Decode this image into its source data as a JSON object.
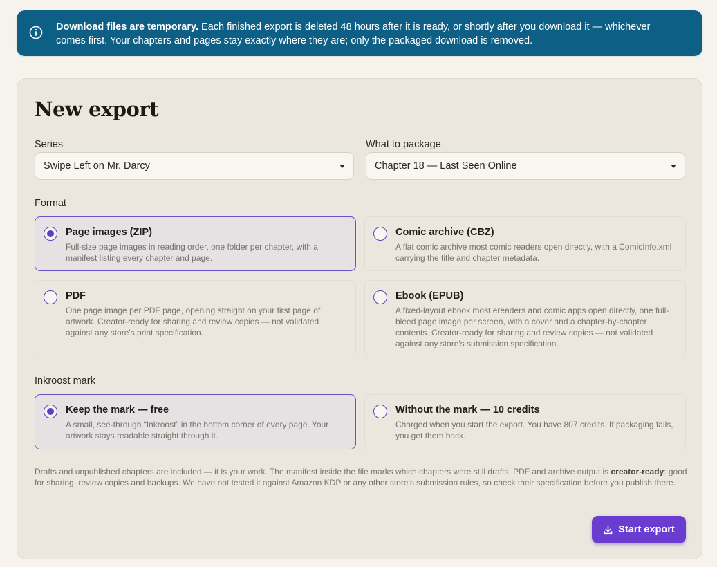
{
  "banner": {
    "icon": "info-icon",
    "bold": "Download files are temporary.",
    "text": " Each finished export is deleted 48 hours after it is ready, or shortly after you download it — whichever comes first. Your chapters and pages stay exactly where they are; only the packaged download is removed."
  },
  "card": {
    "title": "New export",
    "series": {
      "label": "Series",
      "value": "Swipe Left on Mr. Darcy"
    },
    "package": {
      "label": "What to package",
      "value": "Chapter 18 — Last Seen Online"
    },
    "format": {
      "label": "Format",
      "options": [
        {
          "title": "Page images (ZIP)",
          "desc": "Full-size page images in reading order, one folder per chapter, with a manifest listing every chapter and page.",
          "selected": true
        },
        {
          "title": "Comic archive (CBZ)",
          "desc": "A flat comic archive most comic readers open directly, with a ComicInfo.xml carrying the title and chapter metadata.",
          "selected": false
        },
        {
          "title": "PDF",
          "desc": "One page image per PDF page, opening straight on your first page of artwork. Creator-ready for sharing and review copies — not validated against any store's print specification.",
          "selected": false
        },
        {
          "title": "Ebook (EPUB)",
          "desc": "A fixed-layout ebook most ereaders and comic apps open directly, one full-bleed page image per screen, with a cover and a chapter-by-chapter contents. Creator-ready for sharing and review copies — not validated against any store's submission specification.",
          "selected": false
        }
      ]
    },
    "mark": {
      "label": "Inkroost mark",
      "options": [
        {
          "title": "Keep the mark — free",
          "desc": "A small, see-through “Inkroost” in the bottom corner of every page. Your artwork stays readable straight through it.",
          "selected": true
        },
        {
          "title": "Without the mark — 10 credits",
          "desc": "Charged when you start the export. You have 807 credits. If packaging fails, you get them back.",
          "selected": false
        }
      ]
    },
    "footnote_pre": "Drafts and unpublished chapters are included — it is your work. The manifest inside the file marks which chapters were still drafts. PDF and archive output is ",
    "footnote_bold": "creator-ready",
    "footnote_post": ": good for sharing, review copies and backups. We have not tested it against Amazon KDP or any other store's submission rules, so check their specification before you publish there.",
    "start_button": {
      "label": "Start export",
      "icon": "download-icon"
    }
  },
  "colors": {
    "banner_bg": "#0e5f86",
    "accent": "#6a3dd0",
    "page_bg": "#f5f3ec",
    "card_bg": "#ebe7df"
  }
}
